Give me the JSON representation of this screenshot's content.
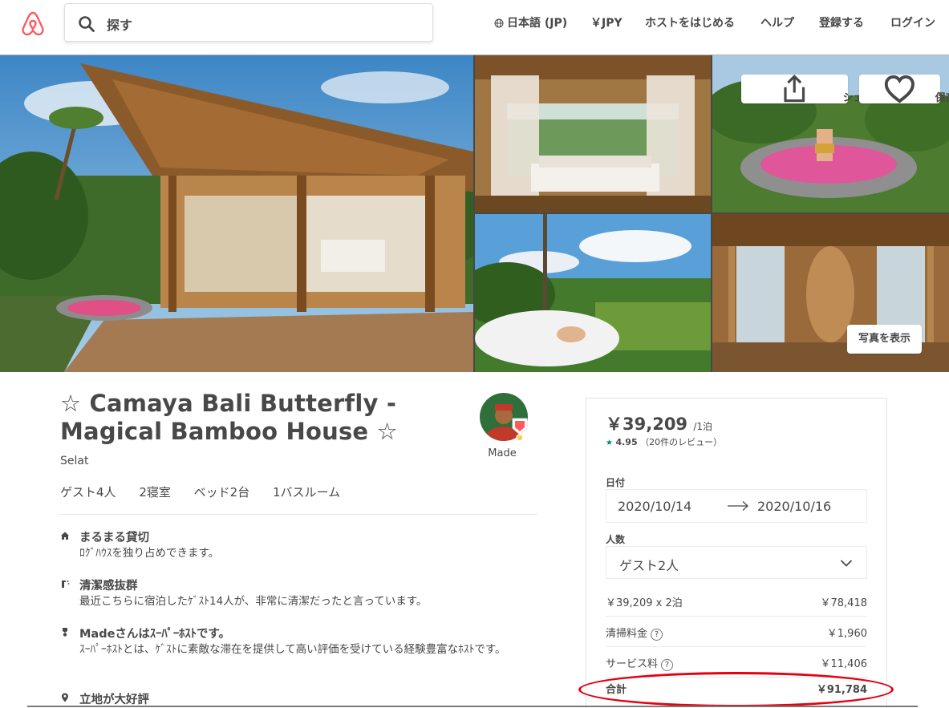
{
  "header": {
    "search_placeholder": "探す",
    "language": "日本語 (JP)",
    "currency": "￥JPY",
    "host": "ホストをはじめる",
    "help": "ヘルプ",
    "signup": "登録する",
    "login": "ログイン"
  },
  "photos": {
    "share_label": "シェアする",
    "save_label": "保存",
    "show_photos_label": "写真を表示"
  },
  "listing": {
    "title": "☆ Camaya Bali Butterfly - Magical Bamboo House ☆",
    "location": "Selat",
    "facts": [
      "ゲスト4人",
      "2寝室",
      "ベッド2台",
      "1バスルーム"
    ],
    "host_name": "Made",
    "highlights": [
      {
        "icon": "home-icon",
        "title": "まるまる貸切",
        "desc": "ﾛｸﾞﾊｳｽを独り占めできます。"
      },
      {
        "icon": "clean-icon",
        "title": "清潔感抜群",
        "desc": "最近こちらに宿泊したｹﾞｽﾄ14人が、非常に清潔だったと言っています。"
      },
      {
        "icon": "medal-icon",
        "title": "Madeさんはｽｰﾊﾟｰﾎｽﾄです。",
        "desc": "ｽｰﾊﾟｰﾎｽﾄとは、ｹﾞｽﾄに素敵な滞在を提供して高い評価を受けている経験豊富なﾎｽﾄです。"
      },
      {
        "icon": "location-pin-icon",
        "title": "立地が大好評",
        "desc": ""
      }
    ]
  },
  "booking": {
    "price": "￥39,209",
    "per_night": "/1泊",
    "rating": "4.95",
    "reviews": "（20件のレビュー）",
    "dates_label": "日付",
    "checkin": "2020/10/14",
    "checkout": "2020/10/16",
    "guests_label": "人数",
    "guests_value": "ゲスト2人",
    "line_items": [
      {
        "label": "￥39,209 x 2泊",
        "value": "￥78,418",
        "help": false
      },
      {
        "label": "清掃料金",
        "value": "￥1,960",
        "help": true
      },
      {
        "label": "サービス料",
        "value": "￥11,406",
        "help": true
      }
    ],
    "total_label": "合計",
    "total_value": "￥91,784",
    "help_glyph": "?"
  },
  "colors": {
    "brand": "#ff5a5f",
    "text": "#484848",
    "rating_star": "#008489",
    "highlight_ring": "#e60012"
  }
}
